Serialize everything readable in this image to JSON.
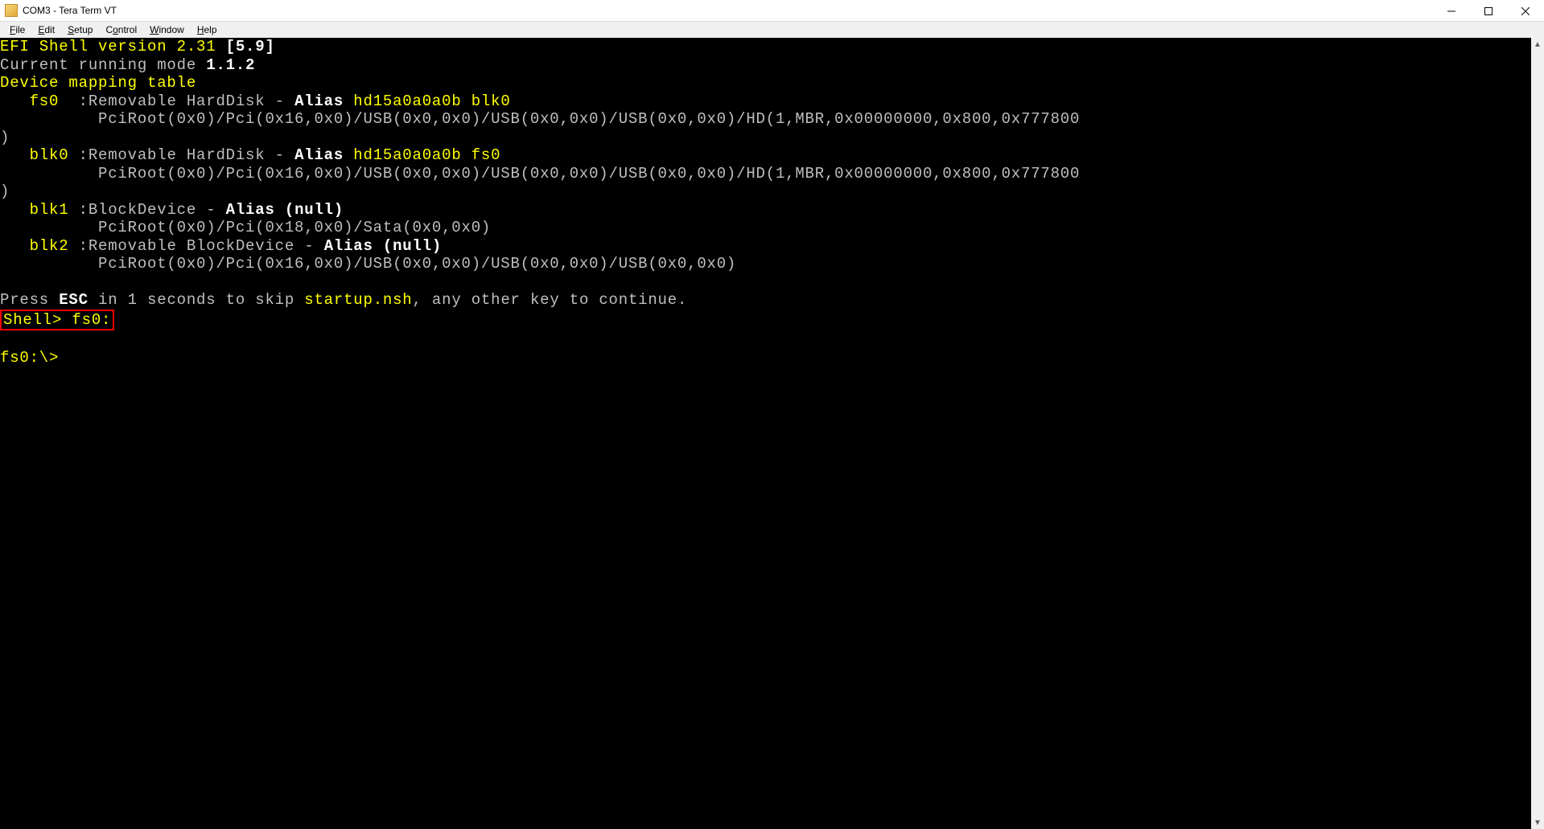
{
  "window": {
    "title": "COM3 - Tera Term VT"
  },
  "menu": {
    "file": {
      "label": "File",
      "ul": "F"
    },
    "edit": {
      "label": "Edit",
      "ul": "E"
    },
    "setup": {
      "label": "Setup",
      "ul": "S"
    },
    "control": {
      "label": "Control",
      "ul": "C"
    },
    "window": {
      "label": "Window",
      "ul": "W"
    },
    "help": {
      "label": "Help",
      "ul": "H"
    }
  },
  "efi": {
    "header_prefix": "EFI Shell version 2.31 ",
    "header_bracket": "[5.9]",
    "running_mode_label": "Current running mode ",
    "running_mode_value": "1.1.2",
    "table_header": "Device mapping table",
    "devices": {
      "fs0": {
        "name": "fs0",
        "sep": "  :",
        "type": "Removable HardDisk - ",
        "alias_label": "Alias ",
        "alias_value": "hd15a0a0a0b blk0",
        "path": "          PciRoot(0x0)/Pci(0x16,0x0)/USB(0x0,0x0)/USB(0x0,0x0)/USB(0x0,0x0)/HD(1,MBR,0x00000000,0x800,0x777800",
        "tail": ")"
      },
      "blk0": {
        "name": "blk0",
        "sep": " :",
        "type": "Removable HardDisk - ",
        "alias_label": "Alias ",
        "alias_value": "hd15a0a0a0b fs0",
        "path": "          PciRoot(0x0)/Pci(0x16,0x0)/USB(0x0,0x0)/USB(0x0,0x0)/USB(0x0,0x0)/HD(1,MBR,0x00000000,0x800,0x777800",
        "tail": ")"
      },
      "blk1": {
        "name": "blk1",
        "sep": " :",
        "type": "BlockDevice - ",
        "alias_label": "Alias ",
        "alias_value": "(null)",
        "path": "          PciRoot(0x0)/Pci(0x18,0x0)/Sata(0x0,0x0)"
      },
      "blk2": {
        "name": "blk2",
        "sep": " :",
        "type": "Removable BlockDevice - ",
        "alias_label": "Alias ",
        "alias_value": "(null)",
        "path": "          PciRoot(0x0)/Pci(0x16,0x0)/USB(0x0,0x0)/USB(0x0,0x0)/USB(0x0,0x0)"
      }
    },
    "esc_line": {
      "pre": "Press ",
      "esc": "ESC",
      "mid": " in 1 seconds to skip ",
      "script": "startup.nsh",
      "post": ", any other key to continue."
    },
    "cmd": {
      "prompt": "Shell> ",
      "input": "fs0:"
    },
    "prompt2": "fs0:\\>",
    "indent": "   "
  }
}
